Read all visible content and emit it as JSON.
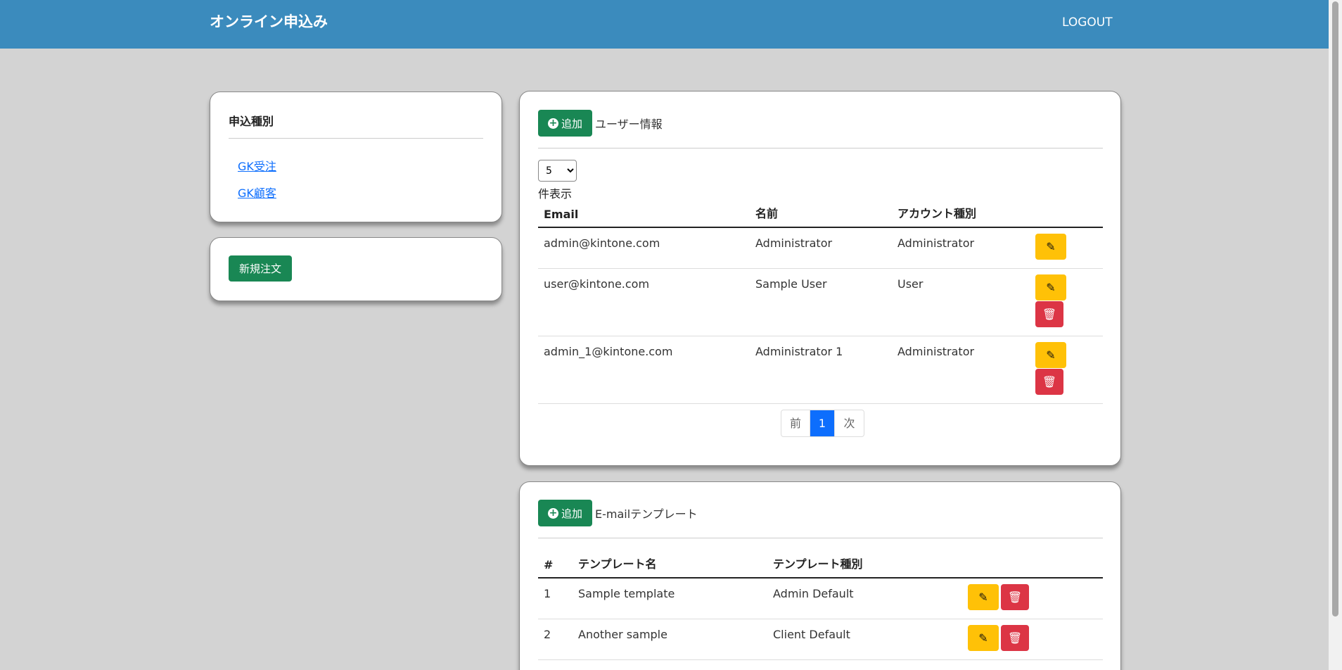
{
  "header": {
    "title": "オンライン申込み",
    "logout_label": "LOGOUT"
  },
  "sidebar": {
    "category_title": "申込種別",
    "links": [
      {
        "label": "GK受注"
      },
      {
        "label": "GK顧客"
      }
    ],
    "new_order_label": "新規注文"
  },
  "users": {
    "add_label": "追加",
    "title": "ユーザー情報",
    "page_size": "5",
    "page_size_options": [
      "5"
    ],
    "per_page_label": "件表示",
    "columns": [
      "Email",
      "名前",
      "アカウント種別"
    ],
    "rows": [
      {
        "email": "admin@kintone.com",
        "name": "Administrator",
        "type": "Administrator"
      },
      {
        "email": "user@kintone.com",
        "name": "Sample User",
        "type": "User"
      },
      {
        "email": "admin_1@kintone.com",
        "name": "Administrator 1",
        "type": "Administrator"
      }
    ],
    "pagination": {
      "prev": "前",
      "current": "1",
      "next": "次"
    }
  },
  "templates": {
    "add_label": "追加",
    "title": "E-mailテンプレート",
    "columns": [
      "#",
      "テンプレート名",
      "テンプレート種別"
    ],
    "rows": [
      {
        "num": "1",
        "name": "Sample template",
        "type": "Admin Default"
      },
      {
        "num": "2",
        "name": "Another sample",
        "type": "Client Default"
      }
    ]
  },
  "colors": {
    "navbar": "#3b8bbd",
    "success": "#198754",
    "warning": "#ffc107",
    "danger": "#dc3545",
    "primary": "#0d6efd",
    "background": "#d3d3d3"
  },
  "icons": {
    "add": "plus-circle-icon",
    "edit": "pencil-square-icon",
    "delete": "trash-icon"
  }
}
